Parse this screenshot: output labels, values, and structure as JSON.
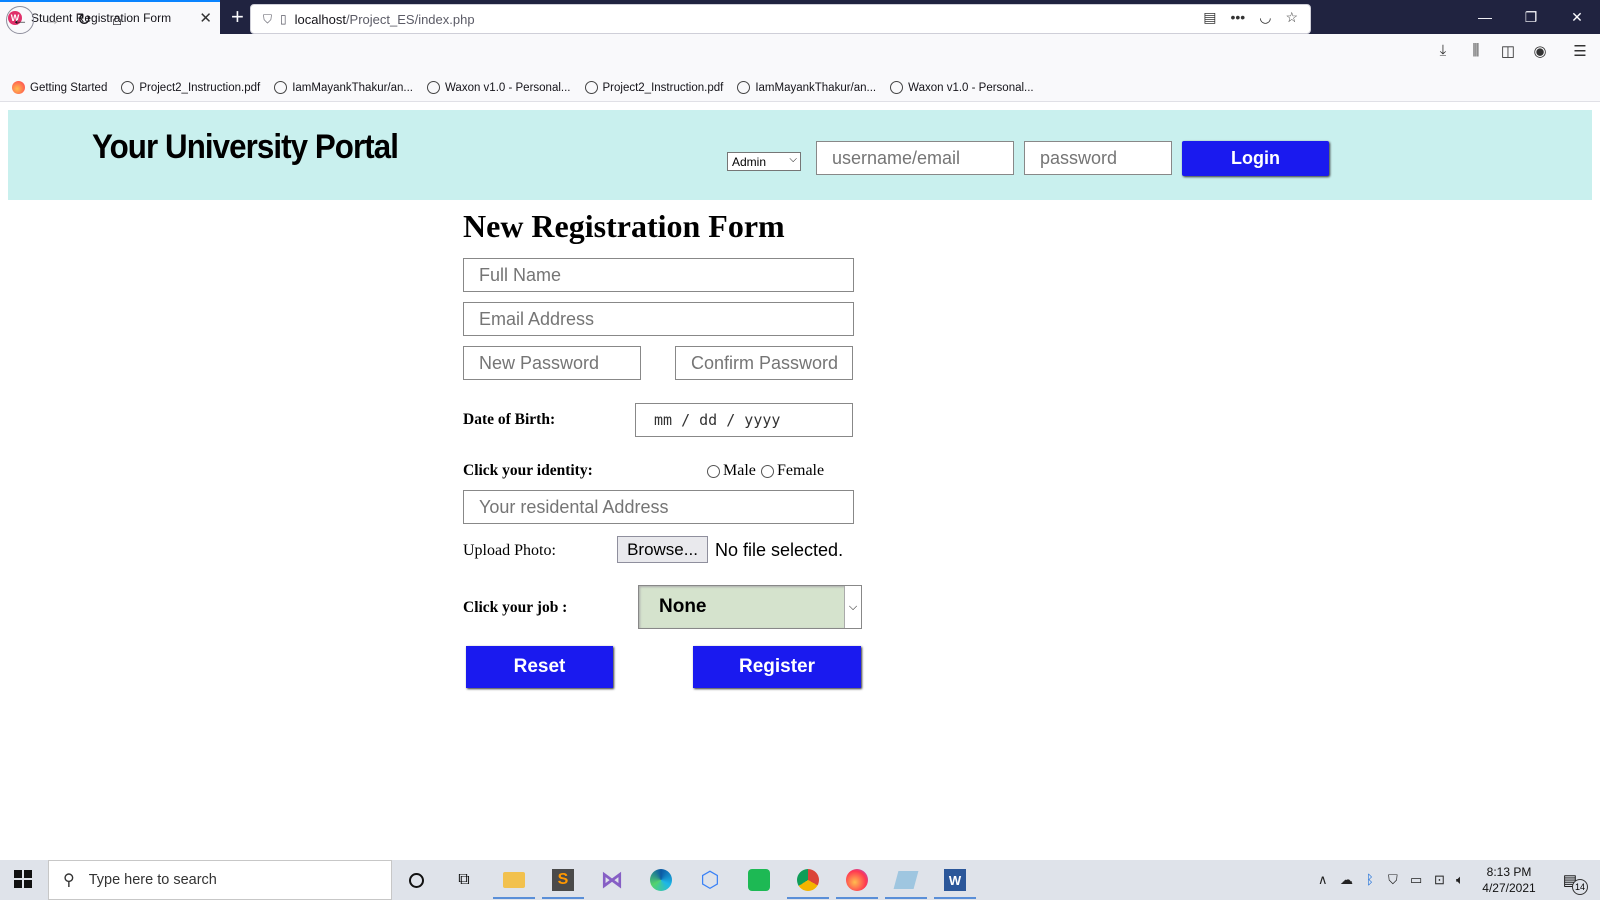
{
  "browser": {
    "tab_title": "Student Registration Form",
    "tab_favicon": "W",
    "url_host": "localhost",
    "url_path": "/Project_ES/index.php",
    "bookmarks": [
      "Getting Started",
      "Project2_Instruction.pdf",
      "IamMayankThakur/an...",
      "Waxon v1.0 - Personal...",
      "Project2_Instruction.pdf",
      "IamMayankThakur/an...",
      "Waxon v1.0 - Personal..."
    ]
  },
  "header": {
    "title": "Your University Portal",
    "role_selected": "Admin",
    "username_placeholder": "username/email",
    "password_placeholder": "password",
    "login_label": "Login",
    "background_color": "#c9f0ee"
  },
  "form": {
    "title": "New Registration Form",
    "full_name_placeholder": "Full Name",
    "email_placeholder": "Email Address",
    "new_password_placeholder": "New Password",
    "confirm_password_placeholder": "Confirm Password",
    "dob_label": "Date of Birth:",
    "dob_placeholder": "mm / dd / yyyy",
    "identity_label": "Click your identity:",
    "gender_options": [
      "Male",
      "Female"
    ],
    "address_placeholder": "Your residental Address",
    "upload_label": "Upload Photo:",
    "browse_label": "Browse...",
    "no_file_text": "No file selected.",
    "job_label": "Click your job :",
    "job_selected": "None",
    "reset_label": "Reset",
    "register_label": "Register",
    "button_color": "#1a1aef"
  },
  "taskbar": {
    "search_placeholder": "Type here to search",
    "time": "8:13 PM",
    "date": "4/27/2021",
    "notification_count": "14"
  }
}
